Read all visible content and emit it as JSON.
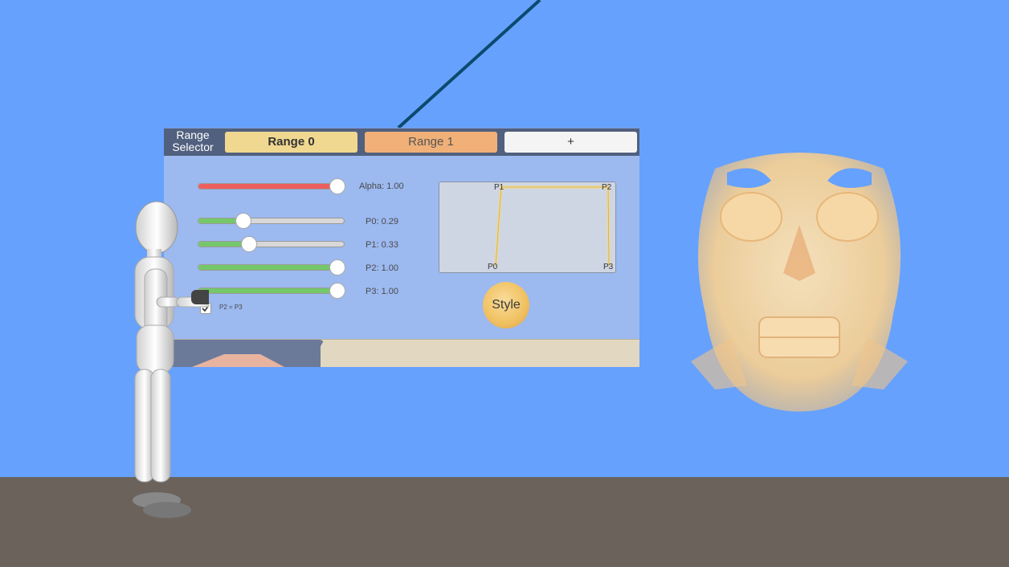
{
  "panel": {
    "title": "Range\nSelector",
    "tabs": [
      {
        "label": "Range 0",
        "active": true
      },
      {
        "label": "Range 1",
        "active": false
      }
    ],
    "add_tab_label": "+",
    "sliders": [
      {
        "id": "alpha",
        "label": "Alpha: 1.00",
        "value": 1.0,
        "color": "#ee5e5e"
      },
      {
        "id": "p0",
        "label": "P0: 0.29",
        "value": 0.29,
        "color": "#74c86a"
      },
      {
        "id": "p1",
        "label": "P1: 0.33",
        "value": 0.33,
        "color": "#74c86a"
      },
      {
        "id": "p2",
        "label": "P2: 1.00",
        "value": 1.0,
        "color": "#74c86a"
      },
      {
        "id": "p3",
        "label": "P3: 1.00",
        "value": 1.0,
        "color": "#74c86a"
      }
    ],
    "link_checkbox": {
      "label": "P2 = P3",
      "checked": true
    },
    "graph_points": {
      "p0": "P0",
      "p1": "P1",
      "p2": "P2",
      "p3": "P3"
    },
    "style_button": "Style"
  },
  "colors": {
    "sky": "#66a1fd",
    "floor": "#6b625c",
    "laser": "#0b4a6e",
    "panel_bg": "#9cb9f0",
    "panel_header": "#50607e"
  },
  "icons": {
    "checkbox": "check-icon"
  }
}
